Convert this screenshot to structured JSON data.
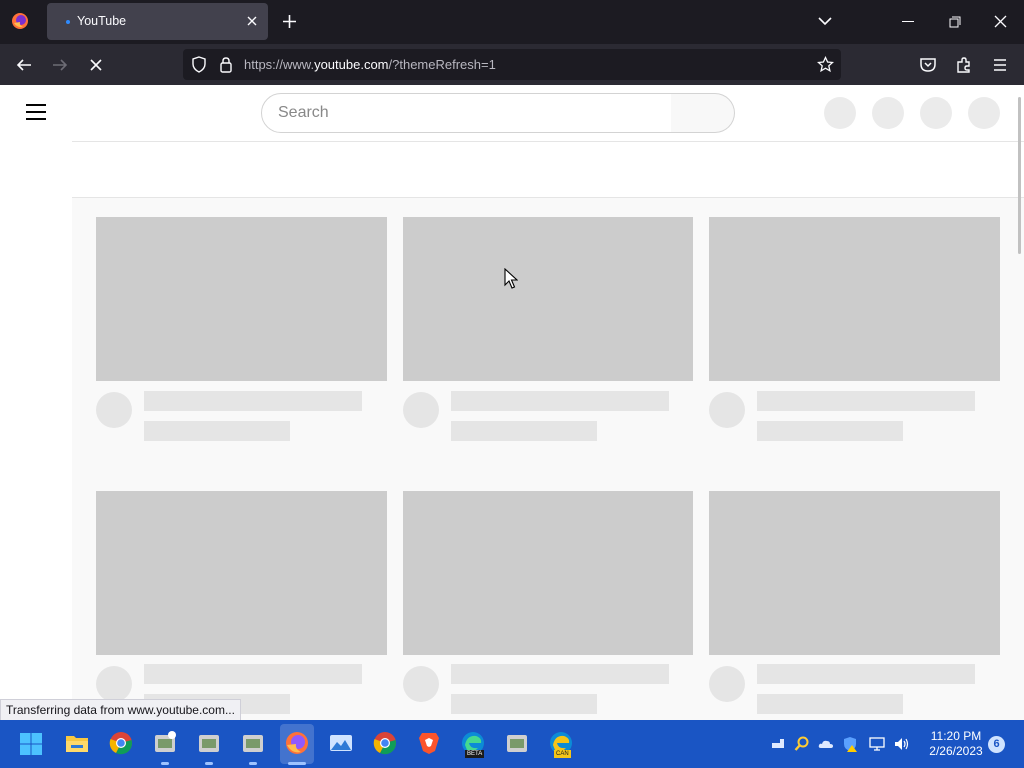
{
  "browser": {
    "tab_title": "YouTube",
    "url_prefix": "https://www.",
    "url_host": "youtube.com",
    "url_path": "/?themeRefresh=1",
    "status_text": "Transferring data from www.youtube.com..."
  },
  "youtube": {
    "search_placeholder": "Search"
  },
  "taskbar": {
    "time": "11:20 PM",
    "date": "2/26/2023",
    "notification_count": "6",
    "edge_beta_badge": "BETA",
    "edge_can_badge": "CAN"
  },
  "colors": {
    "tab_bar": "#1c1b22",
    "nav_bar": "#2b2a33",
    "taskbar": "#1a55c4",
    "skeleton_thumb": "#cccccc",
    "skeleton_text": "#e5e5e5"
  }
}
